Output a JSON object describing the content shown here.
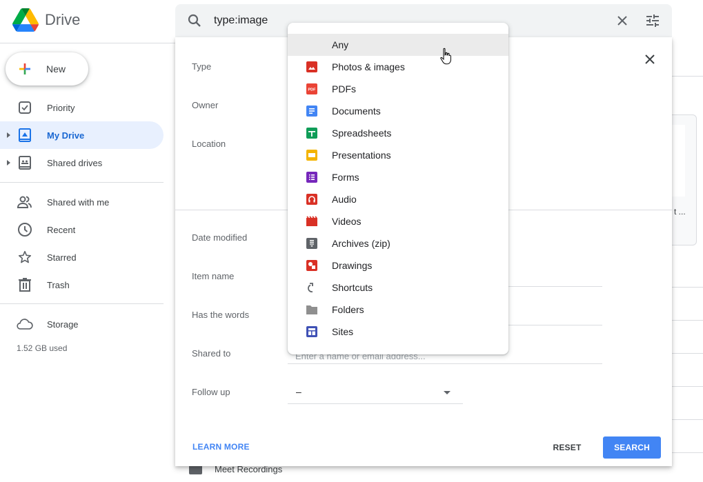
{
  "app": {
    "name": "Drive",
    "new_button": "New"
  },
  "sidebar": {
    "items": [
      {
        "id": "priority",
        "label": "Priority",
        "icon": "priority-check-icon",
        "active": false,
        "expandable": false
      },
      {
        "id": "my-drive",
        "label": "My Drive",
        "icon": "my-drive-icon",
        "active": true,
        "expandable": true
      },
      {
        "id": "shared-drives",
        "label": "Shared drives",
        "icon": "shared-drives-icon",
        "active": false,
        "expandable": true
      },
      {
        "id": "shared-with-me",
        "label": "Shared with me",
        "icon": "people-icon",
        "active": false,
        "expandable": false
      },
      {
        "id": "recent",
        "label": "Recent",
        "icon": "clock-icon",
        "active": false,
        "expandable": false
      },
      {
        "id": "starred",
        "label": "Starred",
        "icon": "star-icon",
        "active": false,
        "expandable": false
      },
      {
        "id": "trash",
        "label": "Trash",
        "icon": "trash-icon",
        "active": false,
        "expandable": false
      },
      {
        "id": "storage",
        "label": "Storage",
        "icon": "cloud-icon",
        "active": false,
        "expandable": false
      }
    ],
    "storage_used": "1.52 GB used"
  },
  "search": {
    "query": "type:image",
    "clear_icon": "close-icon",
    "options_icon": "tune-icon"
  },
  "advanced_search": {
    "fields": {
      "type": "Type",
      "owner": "Owner",
      "location": "Location",
      "date_modified": "Date modified",
      "item_name": "Item name",
      "has_words": "Has the words",
      "shared_to": "Shared to",
      "follow_up": "Follow up"
    },
    "shared_to_placeholder": "Enter a name or email address...",
    "follow_up_value": "–",
    "learn_more": "LEARN MORE",
    "reset": "RESET",
    "search": "SEARCH"
  },
  "type_menu": {
    "hovered": "Any",
    "options": [
      {
        "label": "Any",
        "icon": ""
      },
      {
        "label": "Photos & images",
        "icon": "image-icon",
        "color": "#d93025"
      },
      {
        "label": "PDFs",
        "icon": "pdf-icon",
        "color": "#ea4335"
      },
      {
        "label": "Documents",
        "icon": "docs-icon",
        "color": "#4285f4"
      },
      {
        "label": "Spreadsheets",
        "icon": "sheets-icon",
        "color": "#0f9d58"
      },
      {
        "label": "Presentations",
        "icon": "slides-icon",
        "color": "#f4b400"
      },
      {
        "label": "Forms",
        "icon": "forms-icon",
        "color": "#7627bb"
      },
      {
        "label": "Audio",
        "icon": "audio-icon",
        "color": "#d93025"
      },
      {
        "label": "Videos",
        "icon": "video-icon",
        "color": "#d93025"
      },
      {
        "label": "Archives (zip)",
        "icon": "archive-icon",
        "color": "#5f6368"
      },
      {
        "label": "Drawings",
        "icon": "drawings-icon",
        "color": "#d93025"
      },
      {
        "label": "Shortcuts",
        "icon": "shortcut-icon",
        "color": "#5f6368"
      },
      {
        "label": "Folders",
        "icon": "folder-icon",
        "color": "#8f8f8f"
      },
      {
        "label": "Sites",
        "icon": "sites-icon",
        "color": "#3f51b5"
      }
    ]
  },
  "background": {
    "card_text": "t ...",
    "folder_name": "Meet Recordings"
  },
  "colors": {
    "accent": "#4285f4",
    "active_nav_bg": "#e8f0fe",
    "active_nav_text": "#1967d2"
  }
}
